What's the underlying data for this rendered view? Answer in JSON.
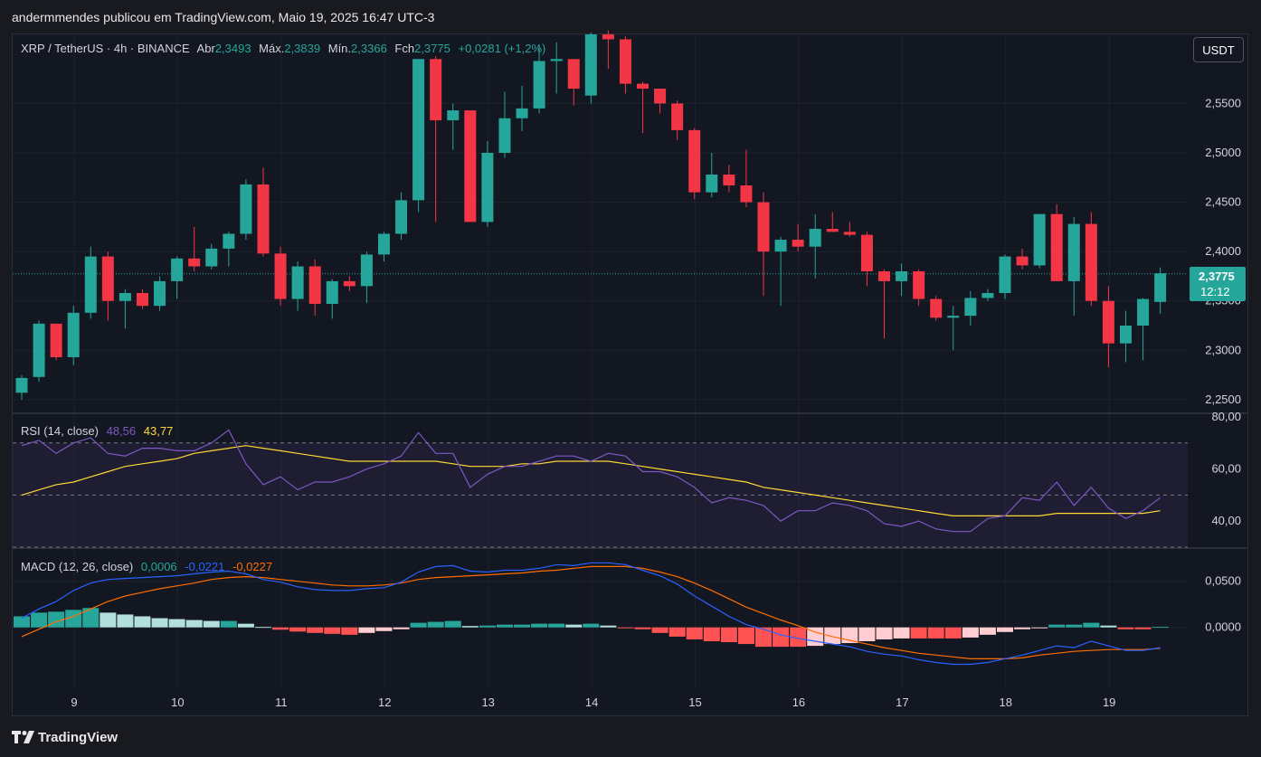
{
  "header": {
    "publisher": "andermmendes publicou em TradingView.com, Maio 19, 2025 16:47 UTC-3"
  },
  "legend": {
    "symbol": "XRP / TetherUS · 4h · BINANCE",
    "open_label": "Abr",
    "open": "2,3493",
    "high_label": "Máx.",
    "high": "2,3839",
    "low_label": "Mín.",
    "low": "2,3366",
    "close_label": "Fch",
    "close": "2,3775",
    "change": "+0,0281 (+1,2%)"
  },
  "currency_button": "USDT",
  "last_price": {
    "price": "2,3775",
    "countdown": "12:12"
  },
  "rsi_legend": {
    "title": "RSI (14, close)",
    "rsi": "48,56",
    "ma": "43,77"
  },
  "macd_legend": {
    "title": "MACD (12, 26, close)",
    "hist": "0,0006",
    "macd": "-0,0221",
    "signal": "-0,0227"
  },
  "colors": {
    "up": "#26a69a",
    "down": "#f23645",
    "rsi": "#7e57c2",
    "rsi_ma": "#fdd835",
    "macd": "#2962ff",
    "signal": "#ff6d00"
  },
  "footer": {
    "logo": "TradingView",
    "logo_icon": "tradingview-logo-icon"
  },
  "chart_data": [
    {
      "type": "candlestick",
      "title": "XRP / TetherUS · 4h · BINANCE",
      "x": [
        "9",
        "",
        "",
        "",
        "",
        "",
        "10",
        "",
        "",
        "",
        "",
        "",
        "11",
        "",
        "",
        "",
        "",
        "",
        "12",
        "",
        "",
        "",
        "",
        "",
        "13",
        "",
        "",
        "",
        "",
        "",
        "14",
        "",
        "",
        "",
        "",
        "",
        "15",
        "",
        "",
        "",
        "",
        "",
        "16",
        "",
        "",
        "",
        "",
        "",
        "17",
        "",
        "",
        "",
        "",
        "",
        "18",
        "",
        "",
        "",
        "",
        "",
        "19",
        "",
        "",
        ""
      ],
      "x_tick_labels": [
        "9",
        "10",
        "11",
        "12",
        "13",
        "14",
        "15",
        "16",
        "17",
        "18",
        "19"
      ],
      "candles": [
        [
          2.257,
          2.275,
          2.25,
          2.272
        ],
        [
          2.273,
          2.33,
          2.268,
          2.327
        ],
        [
          2.327,
          2.325,
          2.29,
          2.293
        ],
        [
          2.293,
          2.345,
          2.285,
          2.338
        ],
        [
          2.338,
          2.405,
          2.332,
          2.395
        ],
        [
          2.395,
          2.4,
          2.33,
          2.35
        ],
        [
          2.35,
          2.362,
          2.322,
          2.358
        ],
        [
          2.358,
          2.362,
          2.342,
          2.345
        ],
        [
          2.345,
          2.375,
          2.34,
          2.37
        ],
        [
          2.37,
          2.395,
          2.352,
          2.393
        ],
        [
          2.393,
          2.425,
          2.38,
          2.385
        ],
        [
          2.385,
          2.408,
          2.382,
          2.403
        ],
        [
          2.403,
          2.42,
          2.385,
          2.418
        ],
        [
          2.418,
          2.473,
          2.412,
          2.468
        ],
        [
          2.468,
          2.485,
          2.395,
          2.398
        ],
        [
          2.398,
          2.405,
          2.345,
          2.352
        ],
        [
          2.352,
          2.39,
          2.34,
          2.385
        ],
        [
          2.385,
          2.392,
          2.335,
          2.347
        ],
        [
          2.347,
          2.372,
          2.332,
          2.37
        ],
        [
          2.37,
          2.375,
          2.36,
          2.365
        ],
        [
          2.365,
          2.4,
          2.348,
          2.397
        ],
        [
          2.397,
          2.42,
          2.39,
          2.418
        ],
        [
          2.418,
          2.46,
          2.412,
          2.452
        ],
        [
          2.452,
          2.595,
          2.44,
          2.595
        ],
        [
          2.595,
          2.598,
          2.43,
          2.533
        ],
        [
          2.533,
          2.55,
          2.503,
          2.543
        ],
        [
          2.543,
          2.543,
          2.43,
          2.43
        ],
        [
          2.43,
          2.512,
          2.425,
          2.5
        ],
        [
          2.5,
          2.562,
          2.495,
          2.535
        ],
        [
          2.535,
          2.568,
          2.522,
          2.545
        ],
        [
          2.545,
          2.61,
          2.54,
          2.593
        ],
        [
          2.593,
          2.612,
          2.56,
          2.595
        ],
        [
          2.595,
          2.565,
          2.548,
          2.565
        ],
        [
          2.558,
          2.622,
          2.55,
          2.62
        ],
        [
          2.62,
          2.624,
          2.585,
          2.615
        ],
        [
          2.615,
          2.618,
          2.56,
          2.57
        ],
        [
          2.57,
          2.572,
          2.52,
          2.565
        ],
        [
          2.565,
          2.565,
          2.54,
          2.55
        ],
        [
          2.55,
          2.553,
          2.513,
          2.523
        ],
        [
          2.523,
          2.525,
          2.453,
          2.46
        ],
        [
          2.46,
          2.5,
          2.455,
          2.478
        ],
        [
          2.478,
          2.488,
          2.46,
          2.467
        ],
        [
          2.467,
          2.503,
          2.445,
          2.45
        ],
        [
          2.45,
          2.46,
          2.355,
          2.4
        ],
        [
          2.4,
          2.415,
          2.345,
          2.412
        ],
        [
          2.412,
          2.428,
          2.4,
          2.405
        ],
        [
          2.405,
          2.438,
          2.373,
          2.423
        ],
        [
          2.423,
          2.44,
          2.42,
          2.42
        ],
        [
          2.42,
          2.43,
          2.415,
          2.417
        ],
        [
          2.417,
          2.42,
          2.365,
          2.38
        ],
        [
          2.38,
          2.382,
          2.312,
          2.37
        ],
        [
          2.37,
          2.388,
          2.355,
          2.38
        ],
        [
          2.38,
          2.382,
          2.345,
          2.352
        ],
        [
          2.352,
          2.355,
          2.33,
          2.333
        ],
        [
          2.333,
          2.345,
          2.3,
          2.335
        ],
        [
          2.335,
          2.36,
          2.325,
          2.353
        ],
        [
          2.353,
          2.362,
          2.35,
          2.358
        ],
        [
          2.358,
          2.397,
          2.352,
          2.395
        ],
        [
          2.395,
          2.403,
          2.382,
          2.386
        ],
        [
          2.386,
          2.438,
          2.383,
          2.438
        ],
        [
          2.438,
          2.448,
          2.37,
          2.37
        ],
        [
          2.37,
          2.435,
          2.335,
          2.428
        ],
        [
          2.428,
          2.44,
          2.345,
          2.35
        ],
        [
          2.35,
          2.365,
          2.283,
          2.307
        ],
        [
          2.307,
          2.34,
          2.288,
          2.325
        ],
        [
          2.325,
          2.353,
          2.29,
          2.352
        ],
        [
          2.349,
          2.384,
          2.337,
          2.378
        ]
      ],
      "y_ticks": [
        "2,2500",
        "2,3000",
        "2,3500",
        "2,4000",
        "2,4500",
        "2,5000",
        "2,5500"
      ],
      "ylim": [
        2.238,
        2.62
      ],
      "last_price": 2.3775
    },
    {
      "type": "line",
      "title": "RSI (14, close)",
      "series": [
        {
          "name": "RSI",
          "values": [
            69,
            71,
            66,
            70,
            72,
            66,
            65,
            68,
            68,
            67,
            67,
            70,
            75,
            62,
            54,
            57,
            52,
            55,
            55,
            57,
            60,
            62,
            65,
            74,
            66,
            66,
            53,
            58,
            61,
            61,
            63,
            65,
            65,
            63,
            66,
            65,
            59,
            59,
            57,
            53,
            47,
            49,
            48,
            46,
            40,
            44,
            44,
            47,
            46,
            44,
            39,
            38,
            40,
            37,
            36,
            36,
            41,
            42,
            49,
            48,
            55,
            46,
            53,
            45,
            41,
            44,
            49
          ]
        },
        {
          "name": "RSI MA",
          "values": [
            50,
            52,
            54,
            55,
            57,
            59,
            61,
            62,
            63,
            64,
            66,
            67,
            68,
            69,
            68,
            67,
            66,
            65,
            64,
            63,
            63,
            63,
            63,
            63,
            63,
            62,
            61,
            61,
            61,
            62,
            62,
            63,
            63,
            63,
            63,
            62,
            61,
            60,
            59,
            58,
            57,
            56,
            55,
            53,
            52,
            51,
            50,
            49,
            48,
            47,
            46,
            45,
            44,
            43,
            42,
            42,
            42,
            42,
            42,
            42,
            43,
            43,
            43,
            43,
            43,
            43,
            44
          ]
        }
      ],
      "y_ticks": [
        "40,00",
        "60,00",
        "80,00"
      ],
      "ylim": [
        30,
        80
      ],
      "bands": [
        30,
        70
      ]
    },
    {
      "type": "bar",
      "title": "MACD (12, 26, close)",
      "series": [
        {
          "name": "Histogram",
          "values": [
            0.012,
            0.016,
            0.017,
            0.019,
            0.021,
            0.016,
            0.014,
            0.012,
            0.01,
            0.009,
            0.008,
            0.007,
            0.007,
            0.004,
            0.0005,
            -0.0025,
            -0.0045,
            -0.006,
            -0.007,
            -0.008,
            -0.006,
            -0.004,
            -0.002,
            0.005,
            0.006,
            0.007,
            0.0015,
            0.002,
            0.003,
            0.003,
            0.004,
            0.004,
            0.003,
            0.004,
            0.002,
            -0.0005,
            -0.002,
            -0.006,
            -0.01,
            -0.013,
            -0.015,
            -0.016,
            -0.018,
            -0.021,
            -0.021,
            -0.021,
            -0.02,
            -0.018,
            -0.017,
            -0.015,
            -0.013,
            -0.012,
            -0.012,
            -0.012,
            -0.012,
            -0.011,
            -0.008,
            -0.005,
            -0.002,
            -0.0005,
            0.003,
            0.003,
            0.005,
            0.002,
            -0.002,
            -0.002,
            0.0006
          ]
        },
        {
          "name": "MACD",
          "values": [
            0.01,
            0.02,
            0.028,
            0.04,
            0.048,
            0.052,
            0.053,
            0.054,
            0.055,
            0.056,
            0.058,
            0.06,
            0.061,
            0.058,
            0.052,
            0.049,
            0.044,
            0.041,
            0.04,
            0.04,
            0.042,
            0.043,
            0.049,
            0.06,
            0.066,
            0.067,
            0.061,
            0.06,
            0.062,
            0.062,
            0.064,
            0.068,
            0.067,
            0.07,
            0.07,
            0.068,
            0.062,
            0.056,
            0.047,
            0.034,
            0.023,
            0.012,
            0.003,
            -0.002,
            -0.008,
            -0.012,
            -0.015,
            -0.018,
            -0.021,
            -0.026,
            -0.029,
            -0.031,
            -0.035,
            -0.038,
            -0.04,
            -0.04,
            -0.038,
            -0.034,
            -0.03,
            -0.025,
            -0.02,
            -0.022,
            -0.015,
            -0.02,
            -0.025,
            -0.025,
            -0.022
          ]
        },
        {
          "name": "Signal",
          "values": [
            -0.01,
            -0.002,
            0.006,
            0.012,
            0.02,
            0.028,
            0.034,
            0.038,
            0.042,
            0.045,
            0.048,
            0.052,
            0.054,
            0.055,
            0.054,
            0.052,
            0.05,
            0.048,
            0.046,
            0.045,
            0.045,
            0.046,
            0.048,
            0.052,
            0.054,
            0.055,
            0.056,
            0.057,
            0.058,
            0.059,
            0.061,
            0.062,
            0.064,
            0.066,
            0.066,
            0.066,
            0.064,
            0.06,
            0.055,
            0.048,
            0.04,
            0.031,
            0.022,
            0.015,
            0.008,
            0.002,
            -0.005,
            -0.01,
            -0.014,
            -0.018,
            -0.022,
            -0.025,
            -0.028,
            -0.03,
            -0.032,
            -0.034,
            -0.034,
            -0.034,
            -0.033,
            -0.03,
            -0.028,
            -0.026,
            -0.025,
            -0.024,
            -0.024,
            -0.024,
            -0.0227
          ]
        }
      ],
      "y_ticks": [
        "0,0000",
        "0,0500"
      ],
      "ylim": [
        -0.065,
        0.085
      ]
    }
  ]
}
